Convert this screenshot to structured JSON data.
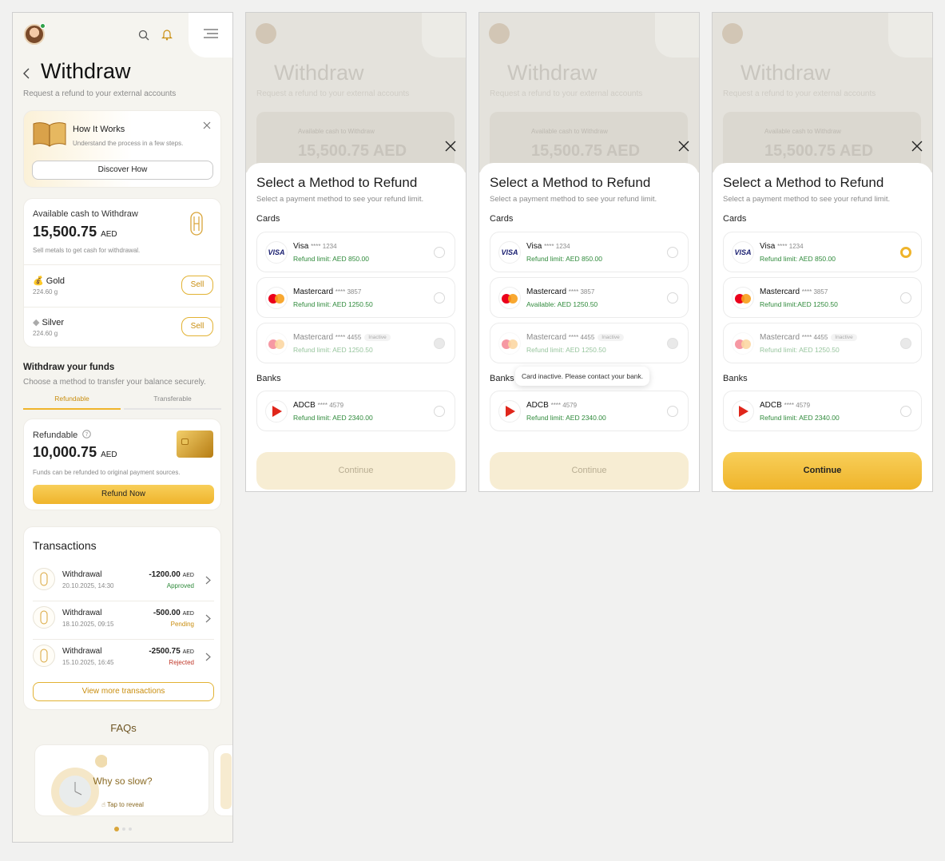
{
  "main": {
    "title": "Withdraw",
    "subtitle": "Request a refund to your external accounts",
    "how": {
      "title": "How It Works",
      "desc": "Understand the process in a few steps.",
      "button": "Discover How"
    },
    "cash": {
      "label": "Available cash to Withdraw",
      "amount": "15,500.75",
      "currency": "AED",
      "note": "Sell metals to get cash for withdrawal.",
      "metals": [
        {
          "name": "Gold",
          "weight": "224.60 g",
          "action": "Sell"
        },
        {
          "name": "Silver",
          "weight": "224.60 g",
          "action": "Sell"
        }
      ]
    },
    "funds": {
      "title": "Withdraw your funds",
      "desc": "Choose a method to transfer your balance securely.",
      "tabs": [
        "Refundable",
        "Transferable"
      ],
      "refundable_label": "Refundable",
      "amount": "10,000.75",
      "currency": "AED",
      "note": "Funds can be refunded to original payment sources.",
      "button": "Refund Now"
    },
    "transactions": {
      "title": "Transactions",
      "items": [
        {
          "name": "Withdrawal",
          "date": "20.10.2025, 14:30",
          "amount": "-1200.00",
          "currency": "AED",
          "status": "Approved"
        },
        {
          "name": "Withdrawal",
          "date": "18.10.2025, 09:15",
          "amount": "-500.00",
          "currency": "AED",
          "status": "Pending"
        },
        {
          "name": "Withdrawal",
          "date": "15.10.2025, 16:45",
          "amount": "-2500.75",
          "currency": "AED",
          "status": "Rejected"
        }
      ],
      "more": "View more transactions"
    },
    "faqs": {
      "title": "FAQs",
      "card_title": "Why so slow?",
      "card_hint": "Tap to reveal"
    }
  },
  "dimmed": {
    "title": "Withdraw",
    "subtitle": "Request a refund to your external accounts",
    "cash_label": "Available cash to Withdraw",
    "amount": "15,500.75",
    "currency": "AED"
  },
  "modals": [
    {
      "title": "Select a Method to Refund",
      "subtitle": "Select a payment method to see your refund limit.",
      "cards_label": "Cards",
      "banks_label": "Banks",
      "options": [
        {
          "name": "Visa",
          "mask": "**** 1234",
          "sub": "Refund limit: AED 850.00"
        },
        {
          "name": "Mastercard",
          "mask": "**** 3857",
          "sub": "Refund limit: AED 1250.50"
        },
        {
          "name": "Mastercard",
          "mask": "**** 4455",
          "sub": "Refund limit: AED 1250.50",
          "badge": "Inactive"
        },
        {
          "name": "ADCB",
          "mask": "**** 4579",
          "sub": "Refund limit: AED 2340.00"
        }
      ],
      "continue": "Continue",
      "continue_enabled": false
    },
    {
      "title": "Select a Method to Refund",
      "subtitle": "Select a payment method to see your refund limit.",
      "cards_label": "Cards",
      "banks_label": "Banks",
      "options": [
        {
          "name": "Visa",
          "mask": "**** 1234",
          "sub": "Refund limit: AED 850.00"
        },
        {
          "name": "Mastercard",
          "mask": "**** 3857",
          "sub": "Available: AED 1250.50"
        },
        {
          "name": "Mastercard",
          "mask": "**** 4455",
          "sub": "Refund limit: AED 1250.50",
          "badge": "Inactive"
        },
        {
          "name": "ADCB",
          "mask": "**** 4579",
          "sub": "Refund limit: AED 2340.00"
        }
      ],
      "tooltip": "Card inactive. Please contact your bank.",
      "continue": "Continue",
      "continue_enabled": false
    },
    {
      "title": "Select a Method to Refund",
      "subtitle": "Select a payment method to see your refund limit.",
      "cards_label": "Cards",
      "banks_label": "Banks",
      "options": [
        {
          "name": "Visa",
          "mask": "**** 1234",
          "sub": "Refund limit: AED 850.00",
          "selected": true
        },
        {
          "name": "Mastercard",
          "mask": "**** 3857",
          "sub": "Refund limit:AED 1250.50"
        },
        {
          "name": "Mastercard",
          "mask": "**** 4455",
          "sub": "Refund limit: AED 1250.50",
          "badge": "Inactive"
        },
        {
          "name": "ADCB",
          "mask": "**** 4579",
          "sub": "Refund limit: AED 2340.00"
        }
      ],
      "continue": "Continue",
      "continue_enabled": true
    }
  ],
  "colors": {
    "accent": "#efb42b",
    "green": "#2f8a3b",
    "gold": "#c98e10",
    "red": "#c0392b"
  },
  "icons": [
    "search-icon",
    "bell-icon",
    "menu-icon",
    "back-icon",
    "close-icon",
    "info-icon",
    "chevron-right-icon",
    "hand-pointer-icon"
  ]
}
